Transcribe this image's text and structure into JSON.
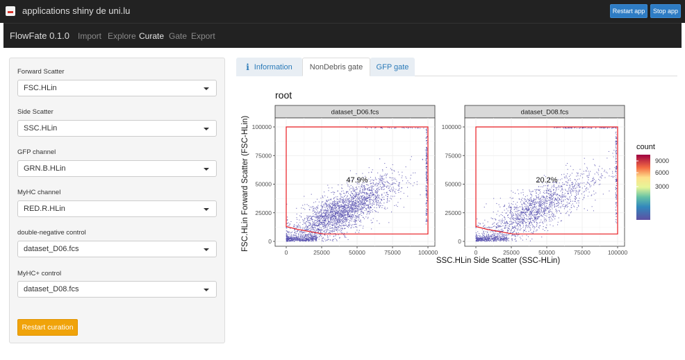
{
  "topbar": {
    "title": "applications shiny de uni.lu",
    "restart_label": "Restart app",
    "stop_label": "Stop app"
  },
  "navbar": {
    "brand": "FlowFate 0.1.0",
    "items": [
      "Import",
      "Explore",
      "Curate",
      "Gate",
      "Export"
    ],
    "active": "Curate"
  },
  "sidebar": {
    "fields": [
      {
        "label": "Forward Scatter",
        "value": "FSC.HLin"
      },
      {
        "label": "Side Scatter",
        "value": "SSC.HLin"
      },
      {
        "label": "GFP channel",
        "value": "GRN.B.HLin"
      },
      {
        "label": "MyHC channel",
        "value": "RED.R.HLin"
      },
      {
        "label": "double-negative control",
        "value": "dataset_D06.fcs"
      },
      {
        "label": "MyHC+ control",
        "value": "dataset_D08.fcs"
      }
    ],
    "restart_button": "Restart curation"
  },
  "tabs": {
    "items": [
      "Information",
      "NonDebris gate",
      "GFP gate"
    ],
    "active": "NonDebris gate"
  },
  "plot": {
    "title": "root",
    "xlabel": "SSC.HLin Side Scatter (SSC-HLin)",
    "ylabel": "FSC.HLin Forward Scatter (FSC-HLin)",
    "x_ticks": [
      "0",
      "25000",
      "50000",
      "75000",
      "100000"
    ],
    "y_ticks": [
      "0",
      "25000",
      "50000",
      "75000",
      "100000"
    ],
    "panels": [
      {
        "name": "dataset_D06.fcs",
        "percent": "47.9%"
      },
      {
        "name": "dataset_D08.fcs",
        "percent": "20.2%"
      }
    ],
    "legend": {
      "title": "count",
      "ticks": [
        "9000",
        "6000",
        "3000"
      ]
    },
    "colors": {
      "gate": "#e8191f",
      "points": "#5b54b0",
      "strip": "#d9d9d9",
      "panel_bg": "#ffffff",
      "grid": "#ebebeb"
    }
  },
  "colors": {
    "navbar": "#222222",
    "accent_button": "#f0a30a",
    "top_button": "#2e7cc4",
    "link": "#2a7ab8"
  }
}
